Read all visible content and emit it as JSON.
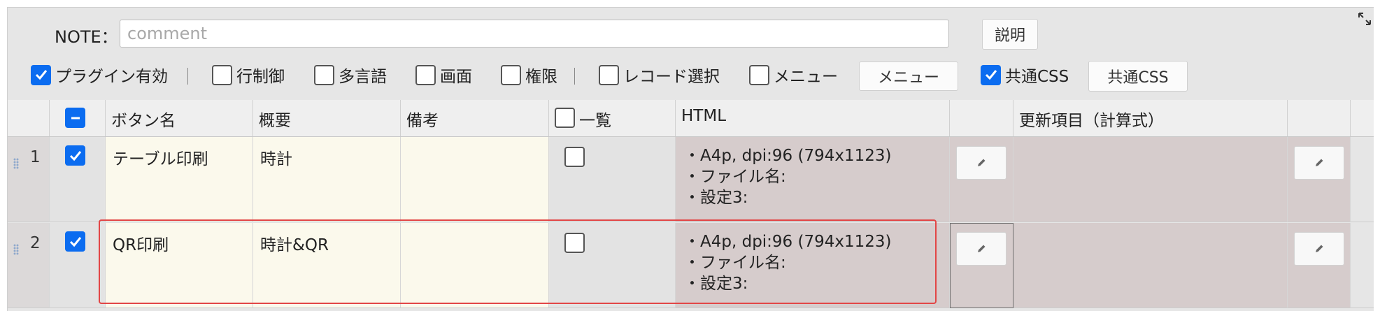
{
  "note": {
    "label": "NOTE：",
    "placeholder": "comment",
    "value": ""
  },
  "toolbar": {
    "help_button": "説明",
    "options": [
      {
        "label": "プラグイン有効",
        "checked": true
      },
      {
        "label": "行制御",
        "checked": false
      },
      {
        "label": "多言語",
        "checked": false
      },
      {
        "label": "画面",
        "checked": false
      },
      {
        "label": "権限",
        "checked": false
      },
      {
        "label": "レコード選択",
        "checked": false
      },
      {
        "label": "メニュー",
        "checked": false
      },
      {
        "label": "共通CSS",
        "checked": true
      }
    ],
    "menu_button": "メニュー",
    "css_button": "共通CSS"
  },
  "table": {
    "headers": {
      "button_name": "ボタン名",
      "summary": "概要",
      "remarks": "備考",
      "list": "一覧",
      "html": "HTML",
      "update_items": "更新項目（計算式）"
    },
    "rows": [
      {
        "number": "1",
        "selected": true,
        "button_name": "テーブル印刷",
        "summary": "時計",
        "remarks": "",
        "list": false,
        "html_lines": [
          "・A4p, dpi:96 (794x1123)",
          "・ファイル名:",
          "・設定3:"
        ],
        "update_items": ""
      },
      {
        "number": "2",
        "selected": true,
        "button_name": "QR印刷",
        "summary": "時計&QR",
        "remarks": "",
        "list": false,
        "html_lines": [
          "・A4p, dpi:96 (794x1123)",
          "・ファイル名:",
          "・設定3:"
        ],
        "update_items": ""
      }
    ]
  },
  "colors": {
    "accent": "#0b6cf0",
    "highlight": "#e24646",
    "cream": "#fbf9ec",
    "mauve": "#d6cccc"
  }
}
